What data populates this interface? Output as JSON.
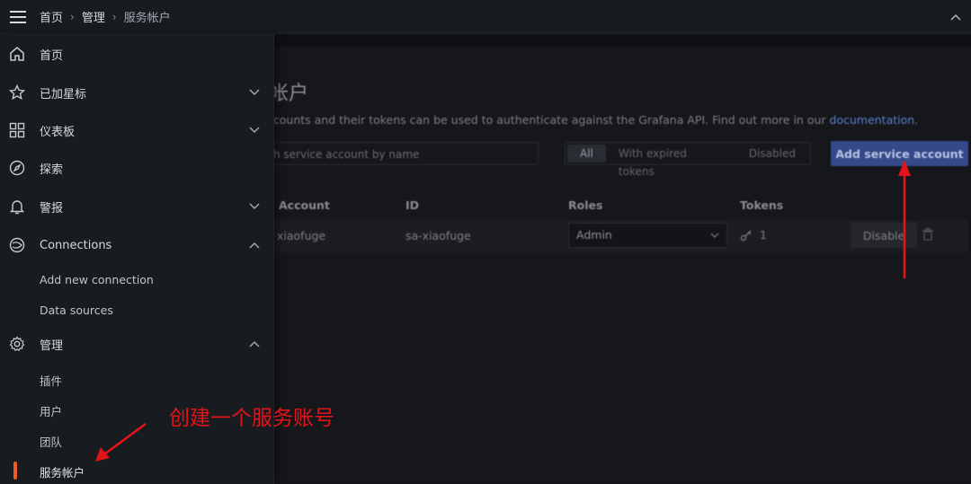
{
  "breadcrumbs": {
    "home": "首页",
    "admin": "管理",
    "current": "服务帐户",
    "separator": "›"
  },
  "sidebar": {
    "items": [
      {
        "label": "首页",
        "icon": "home-icon"
      },
      {
        "label": "已加星标",
        "icon": "star-icon"
      },
      {
        "label": "仪表板",
        "icon": "dashboards-icon"
      },
      {
        "label": "探索",
        "icon": "compass-icon"
      },
      {
        "label": "警报",
        "icon": "bell-icon"
      },
      {
        "label": "Connections",
        "icon": "connections-icon"
      },
      {
        "label": "管理",
        "icon": "gear-icon"
      }
    ],
    "connections_sub": [
      "Add new connection",
      "Data sources"
    ],
    "admin_sub": [
      "插件",
      "用户",
      "团队",
      "服务帐户"
    ]
  },
  "main": {
    "title": "帐户",
    "description": "ccounts and their tokens can be used to authenticate against the Grafana API. Find out more in our ",
    "doc_link": "documentation",
    "desc_end": ".",
    "search_placeholder": "h service account by name",
    "filters": [
      "All",
      "With expired tokens",
      "Disabled"
    ],
    "add_button": "Add service account",
    "columns": {
      "account": "Account",
      "id": "ID",
      "roles": "Roles",
      "tokens": "Tokens"
    },
    "row": {
      "account": "xiaofuge",
      "id": "sa-xiaofuge",
      "role": "Admin",
      "tokens": "1",
      "disable": "Disable"
    }
  },
  "annotation": {
    "text": "创建一个服务账号",
    "color": "#e0141a"
  },
  "colors": {
    "accent": "#f05a28",
    "primary_button": "#34498a",
    "link": "#5b7fcf"
  }
}
